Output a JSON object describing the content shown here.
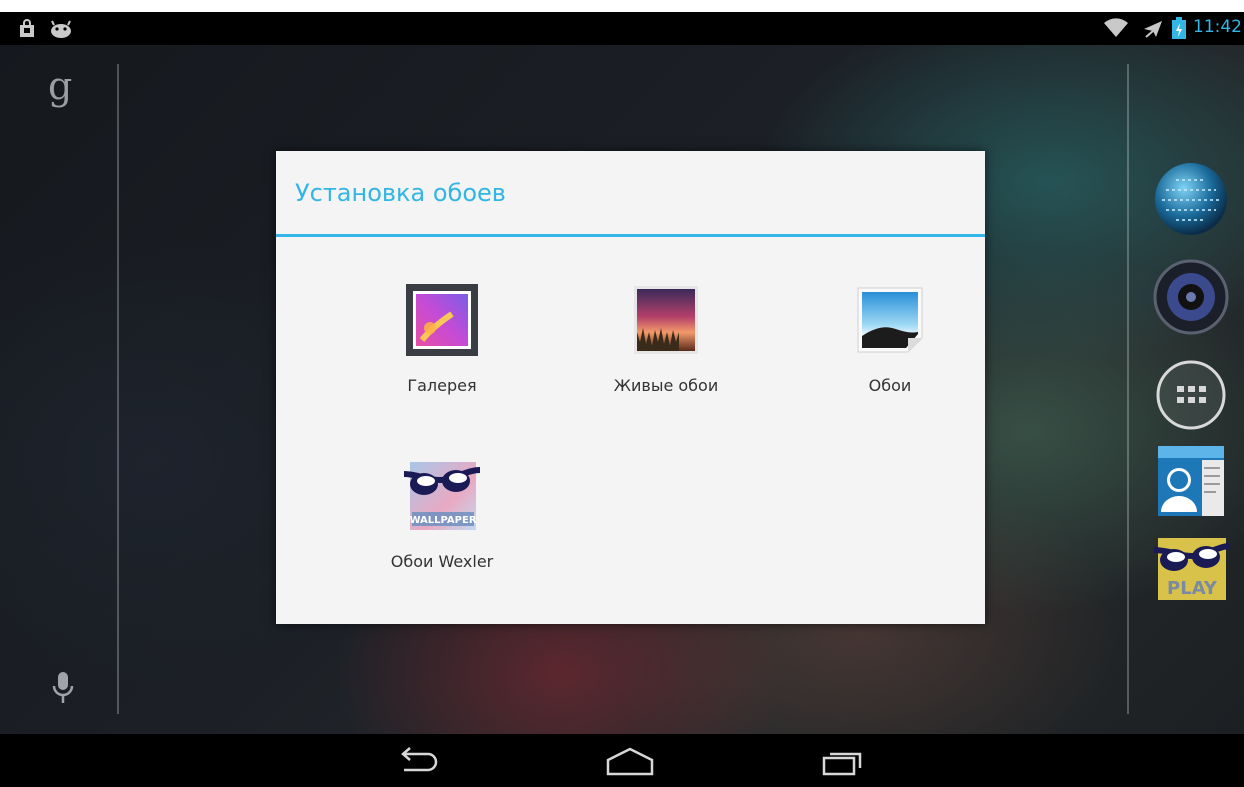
{
  "status_bar": {
    "time": "11:42",
    "left_icons": [
      "shopping-bag-icon",
      "android-debug-icon"
    ],
    "right_icons": [
      "wifi-icon",
      "airplane-mode-icon",
      "battery-charging-icon"
    ],
    "accent_color": "#33b5e5"
  },
  "home": {
    "search_glyph": "g",
    "dock": [
      "earth-app-icon",
      "speaker-app-icon",
      "all-apps-icon",
      "contacts-app-icon",
      "wexler-play-icon"
    ],
    "dock_label": "PLAY"
  },
  "dialog": {
    "title": "Установка обоев",
    "options": [
      {
        "label": "Галерея",
        "icon": "gallery-icon"
      },
      {
        "label": "Живые обои",
        "icon": "live-wallpaper-icon"
      },
      {
        "label": "Обои",
        "icon": "wallpapers-icon"
      },
      {
        "label": "Обои Wexler",
        "icon": "wexler-wallpaper-icon",
        "icon_text": "WALLPAPER"
      }
    ]
  },
  "nav_bar": {
    "buttons": [
      "back",
      "home",
      "recent-apps"
    ]
  }
}
